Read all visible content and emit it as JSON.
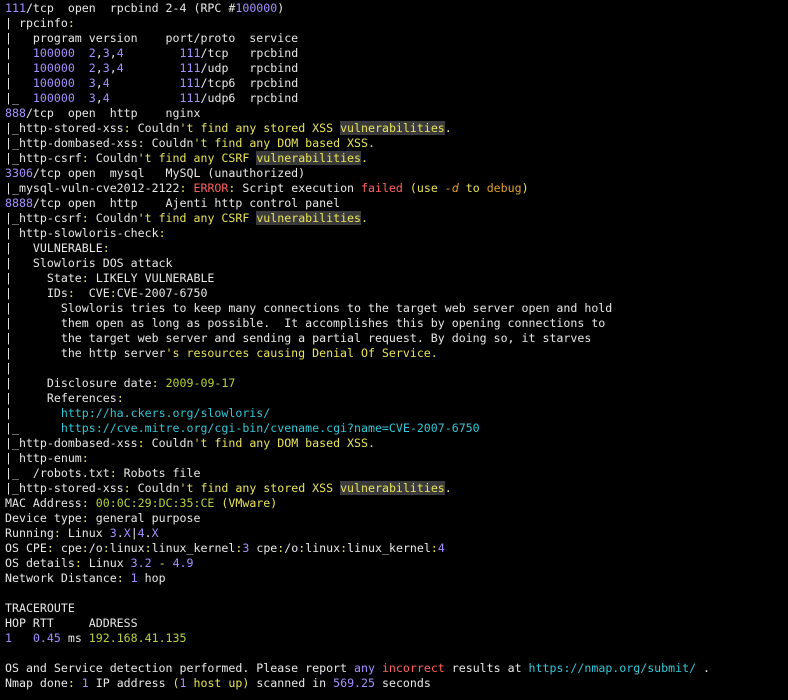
{
  "terminal": {
    "lines": [
      [
        [
          "p",
          "111"
        ],
        [
          "w",
          "/tcp  open  rpcbind 2-4 (RPC #"
        ],
        [
          "p",
          "100000"
        ],
        [
          "w",
          ")"
        ]
      ],
      [
        [
          "w",
          "| rpcinfo"
        ],
        [
          "y",
          ":"
        ]
      ],
      [
        [
          "w",
          "|   program version    port/proto  service"
        ]
      ],
      [
        [
          "w",
          "|   "
        ],
        [
          "p",
          "100000"
        ],
        [
          "w",
          "  "
        ],
        [
          "p",
          "2"
        ],
        [
          "w",
          ","
        ],
        [
          "p",
          "3"
        ],
        [
          "w",
          ","
        ],
        [
          "p",
          "4"
        ],
        [
          "w",
          "        "
        ],
        [
          "p",
          "111"
        ],
        [
          "w",
          "/tcp   rpcbind"
        ]
      ],
      [
        [
          "w",
          "|   "
        ],
        [
          "p",
          "100000"
        ],
        [
          "w",
          "  "
        ],
        [
          "p",
          "2"
        ],
        [
          "w",
          ","
        ],
        [
          "p",
          "3"
        ],
        [
          "w",
          ","
        ],
        [
          "p",
          "4"
        ],
        [
          "w",
          "        "
        ],
        [
          "p",
          "111"
        ],
        [
          "w",
          "/udp   rpcbind"
        ]
      ],
      [
        [
          "w",
          "|   "
        ],
        [
          "p",
          "100000"
        ],
        [
          "w",
          "  "
        ],
        [
          "p",
          "3"
        ],
        [
          "w",
          ","
        ],
        [
          "p",
          "4"
        ],
        [
          "w",
          "          "
        ],
        [
          "p",
          "111"
        ],
        [
          "w",
          "/tcp6  rpcbind"
        ]
      ],
      [
        [
          "w",
          "|_  "
        ],
        [
          "p",
          "100000"
        ],
        [
          "w",
          "  "
        ],
        [
          "p",
          "3"
        ],
        [
          "w",
          ","
        ],
        [
          "p",
          "4"
        ],
        [
          "w",
          "          "
        ],
        [
          "p",
          "111"
        ],
        [
          "w",
          "/udp6  rpcbind"
        ]
      ],
      [
        [
          "p",
          "888"
        ],
        [
          "w",
          "/tcp  open  http    nginx"
        ]
      ],
      [
        [
          "w",
          "|_http-stored-xss"
        ],
        [
          "y",
          ":"
        ],
        [
          "w",
          " Couldn"
        ],
        [
          "y",
          "'t find any stored XSS "
        ],
        [
          "hl",
          "vulnerabilities"
        ],
        [
          "y",
          "."
        ]
      ],
      [
        [
          "w",
          "|_http-dombased-xss"
        ],
        [
          "y",
          ":"
        ],
        [
          "w",
          " Couldn"
        ],
        [
          "y",
          "'t find any DOM based XSS."
        ]
      ],
      [
        [
          "w",
          "|_http-csrf"
        ],
        [
          "y",
          ":"
        ],
        [
          "w",
          " Couldn"
        ],
        [
          "y",
          "'t find any CSRF "
        ],
        [
          "hl",
          "vulnerabilities"
        ],
        [
          "y",
          "."
        ]
      ],
      [
        [
          "p",
          "3306"
        ],
        [
          "w",
          "/tcp open  mysql   MySQL (unauthorized)"
        ]
      ],
      [
        [
          "w",
          "|_mysql-vuln-cve2012-2122"
        ],
        [
          "y",
          ":"
        ],
        [
          "w",
          " "
        ],
        [
          "r",
          "ERROR"
        ],
        [
          "y",
          ":"
        ],
        [
          "w",
          " Script execution "
        ],
        [
          "r",
          "failed"
        ],
        [
          "w",
          " "
        ],
        [
          "y",
          "(use "
        ],
        [
          "i",
          "-d"
        ],
        [
          "y",
          " to "
        ],
        [
          "o",
          "debug"
        ],
        [
          "y",
          ")"
        ]
      ],
      [
        [
          "p",
          "8888"
        ],
        [
          "w",
          "/tcp open  http    Ajenti http control panel"
        ]
      ],
      [
        [
          "w",
          "|_http-csrf"
        ],
        [
          "y",
          ":"
        ],
        [
          "w",
          " Couldn"
        ],
        [
          "y",
          "'t find any CSRF "
        ],
        [
          "hl",
          "vulnerabilities"
        ],
        [
          "y",
          "."
        ]
      ],
      [
        [
          "w",
          "| http-slowloris-check"
        ],
        [
          "y",
          ":"
        ]
      ],
      [
        [
          "w",
          "|   VULNERABLE"
        ],
        [
          "y",
          ":"
        ]
      ],
      [
        [
          "w",
          "|   Slowloris DOS attack"
        ]
      ],
      [
        [
          "w",
          "|     State"
        ],
        [
          "y",
          ":"
        ],
        [
          "w",
          " LIKELY VULNERABLE"
        ]
      ],
      [
        [
          "w",
          "|     IDs"
        ],
        [
          "y",
          ":"
        ],
        [
          "w",
          "  CVE"
        ],
        [
          "y",
          ":"
        ],
        [
          "w",
          "CVE-2007-6750"
        ]
      ],
      [
        [
          "w",
          "|       Slowloris tries to keep many connections to the target web server open and hold"
        ]
      ],
      [
        [
          "w",
          "|       them open as long as possible.  It accomplishes this by opening connections to"
        ]
      ],
      [
        [
          "w",
          "|       the target web server and sending a partial request. By doing so, it starves"
        ]
      ],
      [
        [
          "w",
          "|       the http server"
        ],
        [
          "y",
          "'s resources causing Denial Of Service."
        ]
      ],
      [
        [
          "w",
          "|"
        ]
      ],
      [
        [
          "w",
          "|     Disclosure date"
        ],
        [
          "y",
          ":"
        ],
        [
          "w",
          " "
        ],
        [
          "g",
          "2009-09-17"
        ]
      ],
      [
        [
          "w",
          "|     References"
        ],
        [
          "y",
          ":"
        ]
      ],
      [
        [
          "w",
          "|       "
        ],
        [
          "c",
          "http://ha.ckers.org/slowloris/"
        ]
      ],
      [
        [
          "w",
          "|_      "
        ],
        [
          "c",
          "https://cve.mitre.org/cgi-bin/cvename.cgi?name=CVE-2007-6750"
        ]
      ],
      [
        [
          "w",
          "|_http-dombased-xss"
        ],
        [
          "y",
          ":"
        ],
        [
          "w",
          " Couldn"
        ],
        [
          "y",
          "'t find any DOM based XSS."
        ]
      ],
      [
        [
          "w",
          "| http-enum"
        ],
        [
          "y",
          ":"
        ]
      ],
      [
        [
          "w",
          "|_  /robots.txt"
        ],
        [
          "y",
          ":"
        ],
        [
          "w",
          " Robots file"
        ]
      ],
      [
        [
          "w",
          "|_http-stored-xss"
        ],
        [
          "y",
          ":"
        ],
        [
          "w",
          " Couldn"
        ],
        [
          "y",
          "'t find any stored XSS "
        ],
        [
          "hl",
          "vulnerabilities"
        ],
        [
          "y",
          "."
        ]
      ],
      [
        [
          "w",
          "MAC Address"
        ],
        [
          "y",
          ":"
        ],
        [
          "w",
          " "
        ],
        [
          "g",
          "00:0C:29:DC:35:CE"
        ],
        [
          "w",
          " "
        ],
        [
          "y",
          "(VMware)"
        ]
      ],
      [
        [
          "w",
          "Device type"
        ],
        [
          "y",
          ":"
        ],
        [
          "w",
          " general purpose"
        ]
      ],
      [
        [
          "w",
          "Running"
        ],
        [
          "y",
          ":"
        ],
        [
          "w",
          " Linux "
        ],
        [
          "p",
          "3"
        ],
        [
          "w",
          "."
        ],
        [
          "p",
          "X"
        ],
        [
          "w",
          "|"
        ],
        [
          "p",
          "4"
        ],
        [
          "w",
          "."
        ],
        [
          "p",
          "X"
        ]
      ],
      [
        [
          "w",
          "OS CPE"
        ],
        [
          "y",
          ":"
        ],
        [
          "w",
          " cpe"
        ],
        [
          "y",
          ":"
        ],
        [
          "w",
          "/o"
        ],
        [
          "y",
          ":"
        ],
        [
          "w",
          "linux"
        ],
        [
          "y",
          ":"
        ],
        [
          "w",
          "linux_kernel"
        ],
        [
          "y",
          ":"
        ],
        [
          "p",
          "3"
        ],
        [
          "w",
          " cpe"
        ],
        [
          "y",
          ":"
        ],
        [
          "w",
          "/o"
        ],
        [
          "y",
          ":"
        ],
        [
          "w",
          "linux"
        ],
        [
          "y",
          ":"
        ],
        [
          "w",
          "linux_kernel"
        ],
        [
          "y",
          ":"
        ],
        [
          "p",
          "4"
        ]
      ],
      [
        [
          "w",
          "OS details"
        ],
        [
          "y",
          ":"
        ],
        [
          "w",
          " Linux "
        ],
        [
          "p",
          "3.2"
        ],
        [
          "w",
          " "
        ],
        [
          "y",
          "-"
        ],
        [
          "w",
          " "
        ],
        [
          "p",
          "4.9"
        ]
      ],
      [
        [
          "w",
          "Network Distance"
        ],
        [
          "y",
          ":"
        ],
        [
          "w",
          " "
        ],
        [
          "p",
          "1"
        ],
        [
          "w",
          " hop"
        ]
      ],
      [
        [
          "w",
          ""
        ]
      ],
      [
        [
          "w",
          "TRACEROUTE"
        ]
      ],
      [
        [
          "w",
          "HOP RTT     ADDRESS"
        ]
      ],
      [
        [
          "p",
          "1"
        ],
        [
          "w",
          "   "
        ],
        [
          "p",
          "0.45"
        ],
        [
          "w",
          " ms "
        ],
        [
          "g",
          "192.168.41.135"
        ]
      ],
      [
        [
          "w",
          ""
        ]
      ],
      [
        [
          "w",
          "OS and Service detection performed. Please report "
        ],
        [
          "p",
          "any"
        ],
        [
          "w",
          " "
        ],
        [
          "r",
          "incorrect"
        ],
        [
          "w",
          " results at "
        ],
        [
          "c",
          "https://nmap.org/submit/"
        ],
        [
          "w",
          " ."
        ]
      ],
      [
        [
          "w",
          "Nmap done"
        ],
        [
          "y",
          ":"
        ],
        [
          "w",
          " "
        ],
        [
          "p",
          "1"
        ],
        [
          "w",
          " IP address "
        ],
        [
          "y",
          "("
        ],
        [
          "p",
          "1"
        ],
        [
          "y",
          " host up)"
        ],
        [
          "w",
          " scanned in "
        ],
        [
          "p",
          "569.25"
        ],
        [
          "w",
          " seconds"
        ]
      ]
    ]
  },
  "colors": {
    "background": "#000000",
    "text": "#e8e8e8",
    "number": "#a690ff",
    "punctuation_yellow": "#e8e35a",
    "orange": "#e0a030",
    "error_red": "#ff6060",
    "green": "#b6d33c",
    "link_cyan": "#33c6d6",
    "highlight_bg": "#3b3b3b"
  }
}
